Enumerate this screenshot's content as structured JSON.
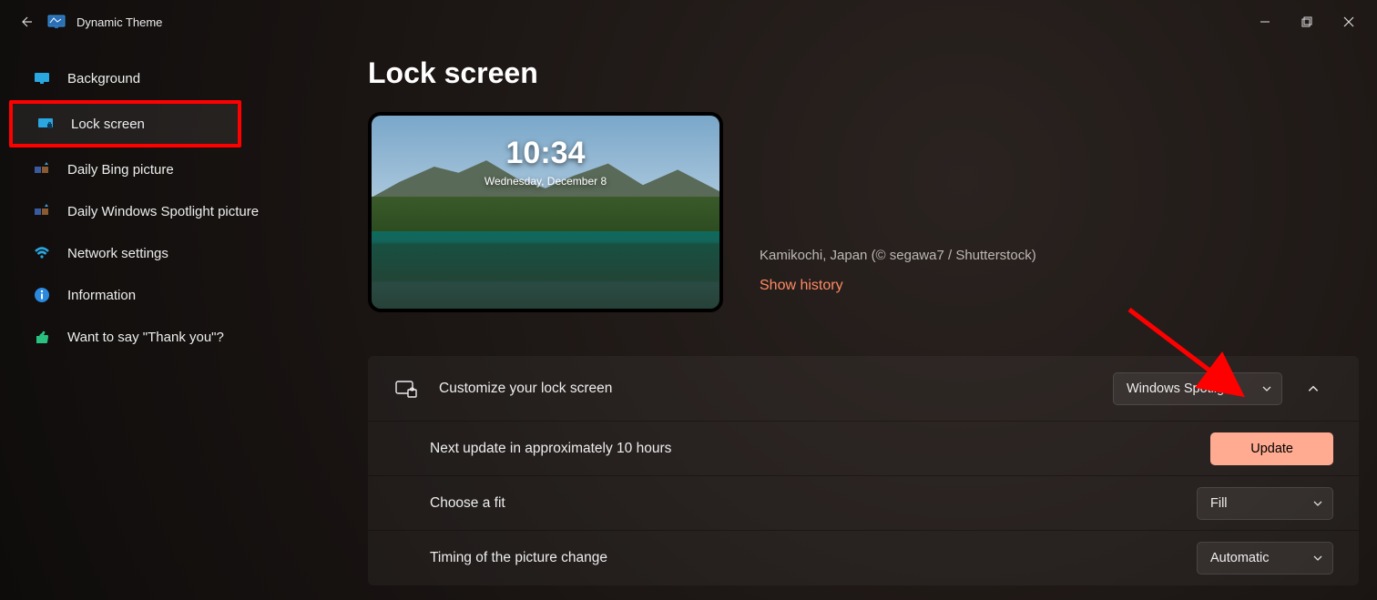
{
  "app": {
    "title": "Dynamic Theme"
  },
  "sidebar": {
    "items": [
      {
        "label": "Background"
      },
      {
        "label": "Lock screen"
      },
      {
        "label": "Daily Bing picture"
      },
      {
        "label": "Daily Windows Spotlight picture"
      },
      {
        "label": "Network settings"
      },
      {
        "label": "Information"
      },
      {
        "label": "Want to say \"Thank you\"?"
      }
    ]
  },
  "page": {
    "title": "Lock screen",
    "preview": {
      "time": "10:34",
      "date": "Wednesday, December 8",
      "caption": "Kamikochi, Japan (© segawa7 / Shutterstock)",
      "show_history": "Show history"
    },
    "customize": {
      "label": "Customize your lock screen",
      "source": "Windows Spotlight",
      "update_status": "Next update in approximately 10 hours",
      "update_btn": "Update",
      "fit_label": "Choose a fit",
      "fit_value": "Fill",
      "timing_label": "Timing of the picture change",
      "timing_value": "Automatic"
    }
  }
}
